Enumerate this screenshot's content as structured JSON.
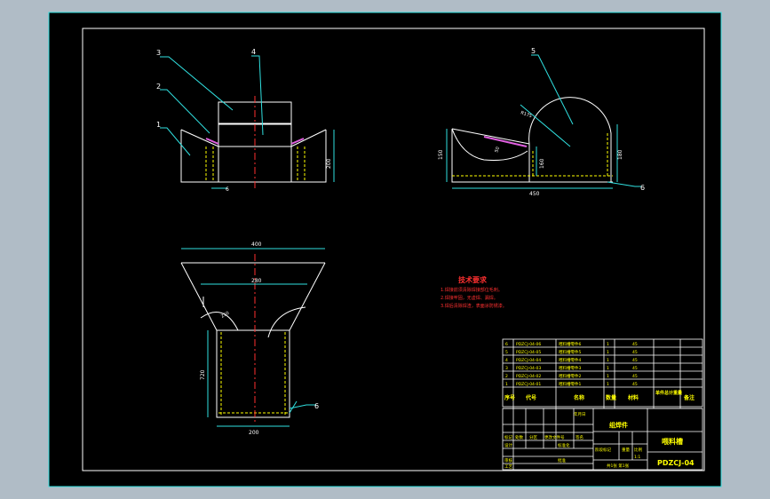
{
  "drawing": {
    "tech_title": "技术要求",
    "tech_notes": [
      "1.焊接前须清除焊接部位毛刺。",
      "2.焊接牢固，无虚焊、漏焊。",
      "3.焊后清除焊渣，表面涂防锈漆。"
    ],
    "labels": {
      "balloon_1": "1",
      "balloon_2": "2",
      "balloon_3": "3",
      "balloon_4": "4",
      "balloon_5": "5",
      "balloon_6": "6"
    },
    "dimensions": {
      "front_6": "6",
      "front_200": "200",
      "side_150": "150",
      "side_160": "160",
      "side_180": "180",
      "side_450": "450",
      "side_50": "50",
      "side_r": "R175",
      "bottom_400": "400",
      "bottom_280": "280",
      "bottom_720": "720",
      "bottom_250": "250",
      "bottom_200": "200",
      "bottom_6": "6"
    }
  },
  "parts_table": {
    "rows": [
      {
        "no": "6",
        "code": "PDZCJ-04-06",
        "name": "喂料槽零件6",
        "qty": "1",
        "mat": "45"
      },
      {
        "no": "5",
        "code": "PDZCJ-04-05",
        "name": "喂料槽零件5",
        "qty": "1",
        "mat": "45"
      },
      {
        "no": "4",
        "code": "PDZCJ-04-04",
        "name": "喂料槽零件4",
        "qty": "1",
        "mat": "45"
      },
      {
        "no": "3",
        "code": "PDZCJ-04-03",
        "name": "喂料槽零件3",
        "qty": "1",
        "mat": "45"
      },
      {
        "no": "2",
        "code": "PDZCJ-04-02",
        "name": "喂料槽零件2",
        "qty": "1",
        "mat": "45"
      },
      {
        "no": "1",
        "code": "PDZCJ-04-01",
        "name": "喂料槽零件1",
        "qty": "1",
        "mat": "45"
      }
    ],
    "header": {
      "no": "序号",
      "code": "代号",
      "name": "名称",
      "qty": "数量",
      "mat": "材料",
      "weight": "单件总计重量",
      "remark": "备注"
    }
  },
  "title_block": {
    "assembly": "组焊件",
    "part_name": "喂料槽",
    "drawing_no": "PDZCJ-04",
    "scale": "1:1",
    "stage_label": "阶段标记",
    "weight_label": "重量",
    "scale_label": "比例",
    "design": "设计",
    "check": "审核",
    "process": "工艺",
    "standard": "标准化",
    "approve": "批准",
    "sheet": "共1张 第1张",
    "mark": "标记",
    "count": "处数",
    "zone": "分区",
    "change_no": "更改文件号",
    "sign": "签名",
    "date": "年月日"
  }
}
